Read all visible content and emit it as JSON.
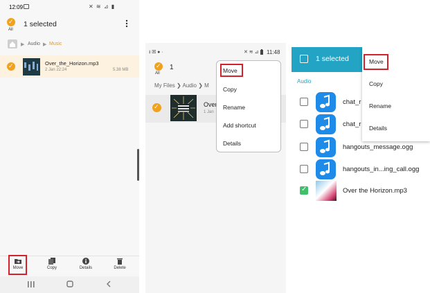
{
  "panel1": {
    "status": {
      "time": "12:09"
    },
    "header": {
      "all_label": "All",
      "title": "1 selected"
    },
    "breadcrumb": {
      "parent": "Audio",
      "current": "Music"
    },
    "file": {
      "name": "Over_the_Horizon.mp3",
      "date": "2 Jan 22:24",
      "size": "5.38 MB"
    },
    "actions": [
      {
        "label": "Move",
        "icon": "folder-move-icon"
      },
      {
        "label": "Copy",
        "icon": "copy-icon"
      },
      {
        "label": "Details",
        "icon": "info-icon"
      },
      {
        "label": "Delete",
        "icon": "trash-icon"
      }
    ]
  },
  "panel2": {
    "status": {
      "time": "11:48"
    },
    "header": {
      "all_label": "All",
      "count": "1"
    },
    "breadcrumb": {
      "root": "My Files",
      "parent": "Audio",
      "current": "M"
    },
    "file": {
      "name": "Over",
      "date": "1 Jan"
    },
    "menu": [
      "Move",
      "Copy",
      "Rename",
      "Add shortcut",
      "Details"
    ]
  },
  "panel3": {
    "header": {
      "title": "1 selected"
    },
    "section_title": "Audio",
    "files": [
      {
        "name": "chat_r",
        "checked": false
      },
      {
        "name": "chat_r",
        "checked": false
      },
      {
        "name": "hangouts_message.ogg",
        "checked": false
      },
      {
        "name": "hangouts_in...ing_call.ogg",
        "checked": false
      },
      {
        "name": "Over the Horizon.mp3",
        "checked": true
      }
    ],
    "menu": [
      "Move",
      "Copy",
      "Rename",
      "Details"
    ]
  },
  "colors": {
    "accent_orange": "#f0a21c",
    "highlight_red": "#d4222c",
    "teal_bar": "#23a4c4",
    "check_green": "#3fbf6a"
  }
}
